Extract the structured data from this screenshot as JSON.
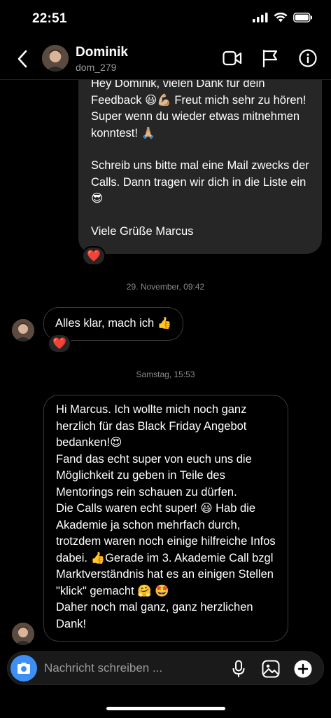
{
  "status": {
    "time": "22:51"
  },
  "header": {
    "name": "Dominik",
    "username": "dom_279"
  },
  "messages": {
    "outgoing_1": {
      "p1": "Hey Dominik, vielen Dank für dein Feedback 😃💪🏼 Freut mich sehr zu hören! Super wenn du wieder etwas mitnehmen konntest! 🙏🏼",
      "p2": "Schreib uns bitte mal eine Mail zwecks der Calls. Dann tragen wir dich in die Liste ein 😎",
      "p3": "Viele Grüße Marcus",
      "reaction": "❤️"
    },
    "timestamp_1": "29. November, 09:42",
    "incoming_1": {
      "text": "Alles klar, mach ich 👍",
      "reaction": "❤️"
    },
    "timestamp_2": "Samstag, 15:53",
    "incoming_2": {
      "text": "Hi Marcus. Ich wollte mich noch ganz herzlich für das Black Friday Angebot bedanken!😍\nFand das echt super von euch uns die Möglichkeit zu geben in Teile des Mentorings rein schauen zu dürfen.\nDie Calls waren echt super! 😃 Hab die Akademie ja schon mehrfach durch, trotzdem waren noch einige hilfreiche Infos dabei. 👍Gerade im 3. Akademie Call bzgl Marktverständnis hat es an einigen Stellen \"klick\" gemacht 🤗 🤩\nDaher noch mal ganz, ganz herzlichen Dank!"
    }
  },
  "composer": {
    "placeholder": "Nachricht schreiben ..."
  },
  "colors": {
    "accent": "#3d8ff5",
    "bubble_out": "#262626",
    "reaction_heart": "#e0245e"
  },
  "icons": [
    "back-chevron",
    "video-camera",
    "flag",
    "info",
    "camera",
    "microphone",
    "gallery",
    "plus"
  ]
}
